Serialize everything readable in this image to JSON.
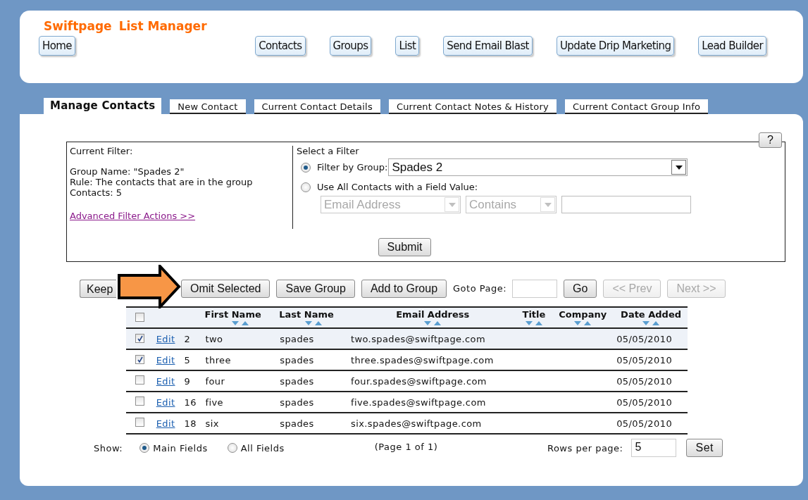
{
  "app": {
    "brand": "Swiftpage",
    "title": "List Manager"
  },
  "nav": [
    {
      "label": "Home"
    },
    {
      "label": "Contacts"
    },
    {
      "label": "Groups"
    },
    {
      "label": "List"
    },
    {
      "label": "Send Email Blast"
    },
    {
      "label": "Update Drip Marketing"
    },
    {
      "label": "Lead Builder"
    }
  ],
  "tabs": [
    {
      "label": "Manage Contacts",
      "selected": true
    },
    {
      "label": "New Contact",
      "selected": false
    },
    {
      "label": "Current Contact Details",
      "selected": false
    },
    {
      "label": "Current Contact Notes & History",
      "selected": false
    },
    {
      "label": "Current Contact Group Info",
      "selected": false
    }
  ],
  "help_button": "?",
  "filter": {
    "current_label": "Current Filter:",
    "lines": [
      "Group Name: \"Spades 2\"",
      "Rule: The contacts that are in the group",
      "Contacts: 5"
    ],
    "advanced_link": "Advanced Filter Actions >>",
    "select_title": "Select a Filter",
    "options": [
      {
        "label": "Filter by Group:",
        "selected": true
      },
      {
        "label": "Use All Contacts with a Field Value:",
        "selected": false
      }
    ],
    "group_select": {
      "value": "Spades 2",
      "disabled": false
    },
    "field_select": {
      "value": "Email Address",
      "disabled": true
    },
    "operator_select": {
      "value": "Contains",
      "disabled": true
    },
    "submit": "Submit"
  },
  "toolbar": [
    {
      "kind": "button",
      "label": "Keep",
      "disabled": false
    },
    {
      "kind": "button",
      "label": "Omit Selected",
      "disabled": false
    },
    {
      "kind": "button",
      "label": "Save Group",
      "disabled": false
    },
    {
      "kind": "button",
      "label": "Add to Group",
      "disabled": false
    },
    {
      "kind": "label",
      "label": "Goto Page:"
    },
    {
      "kind": "input"
    },
    {
      "kind": "button",
      "label": "Go",
      "disabled": false
    },
    {
      "kind": "button",
      "label": "<< Prev",
      "disabled": true
    },
    {
      "kind": "button",
      "label": "Next >>",
      "disabled": true
    }
  ],
  "table": {
    "select_all": {
      "checked": false
    },
    "columns": [
      "First Name",
      "Last Name",
      "Email Address",
      "Title",
      "Company",
      "Date Added"
    ],
    "rows": [
      {
        "checked": true,
        "highlighted": true,
        "edit": "Edit",
        "id": "2",
        "first": "two",
        "last": "spades",
        "email": "two.spades@swiftpage.com",
        "date": "05/05/2010"
      },
      {
        "checked": true,
        "highlighted": false,
        "edit": "Edit",
        "id": "5",
        "first": "three",
        "last": "spades",
        "email": "three.spades@swiftpage.com",
        "date": "05/05/2010"
      },
      {
        "checked": false,
        "highlighted": false,
        "edit": "Edit",
        "id": "9",
        "first": "four",
        "last": "spades",
        "email": "four.spades@swiftpage.com",
        "date": "05/05/2010"
      },
      {
        "checked": false,
        "highlighted": false,
        "edit": "Edit",
        "id": "16",
        "first": "five",
        "last": "spades",
        "email": "five.spades@swiftpage.com",
        "date": "05/05/2010"
      },
      {
        "checked": false,
        "highlighted": false,
        "edit": "Edit",
        "id": "18",
        "first": "six",
        "last": "spades",
        "email": "six.spades@swiftpage.com",
        "date": "05/05/2010"
      }
    ]
  },
  "footer": {
    "show_label": "Show:",
    "options": [
      {
        "label": "Main Fields",
        "selected": true
      },
      {
        "label": "All Fields",
        "selected": false
      }
    ],
    "page_info": "(Page 1 of 1)",
    "rows_label": "Rows per page:",
    "rows_value": "5",
    "set": "Set"
  }
}
